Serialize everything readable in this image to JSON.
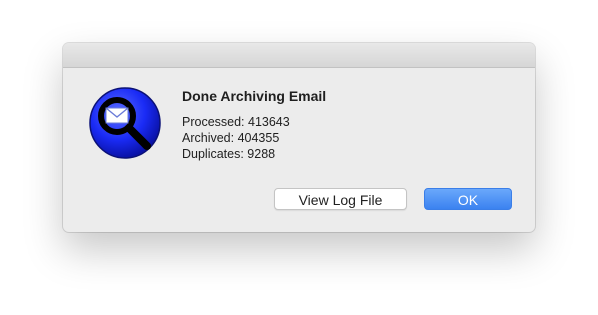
{
  "dialog": {
    "heading": "Done Archiving Email",
    "stats": {
      "processed": "Processed: 413643",
      "archived": "Archived: 404355",
      "duplicates": "Duplicates: 9288"
    },
    "buttons": {
      "view_log_label": "View Log File",
      "ok_label": "OK"
    }
  },
  "icon": {
    "name": "mail-search-app-icon",
    "colors": {
      "disc": "#1a2bf5",
      "ring": "#000000",
      "envelope": "#ffffff"
    }
  },
  "colors": {
    "primary_button": "#3b82f0",
    "dialog_background": "#ececec"
  }
}
